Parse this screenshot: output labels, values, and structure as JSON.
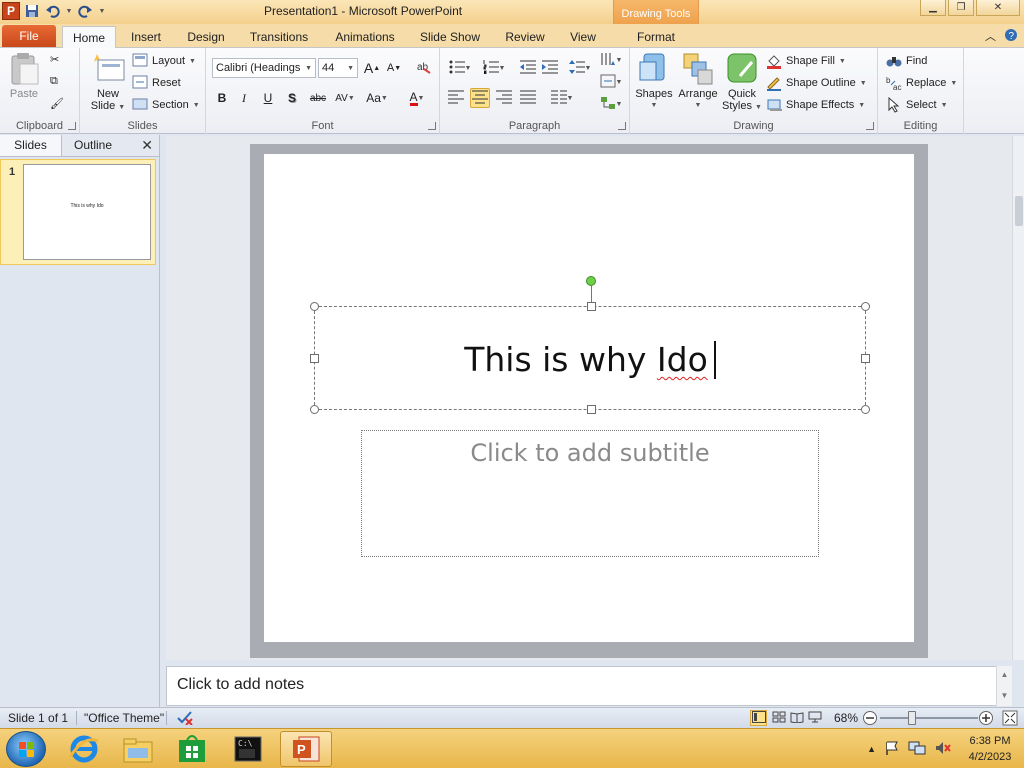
{
  "window": {
    "title": "Presentation1  -  Microsoft PowerPoint",
    "context_tab_group": "Drawing Tools",
    "app_icon_letter": "P"
  },
  "tabs": {
    "file": "File",
    "home": "Home",
    "insert": "Insert",
    "design": "Design",
    "transitions": "Transitions",
    "animations": "Animations",
    "slideshow": "Slide Show",
    "review": "Review",
    "view": "View",
    "format": "Format"
  },
  "ribbon": {
    "clipboard": {
      "label": "Clipboard",
      "paste": "Paste"
    },
    "slides": {
      "label": "Slides",
      "new_slide_l1": "New",
      "new_slide_l2": "Slide",
      "layout": "Layout",
      "reset": "Reset",
      "section": "Section"
    },
    "font": {
      "label": "Font",
      "font_name": "Calibri (Headings",
      "font_size": "44",
      "grow": "A",
      "shrink": "A",
      "bold": "B",
      "italic": "I",
      "underline": "U",
      "shadow": "S",
      "strike": "abc",
      "spacing": "AV",
      "change_case": "Aa",
      "color": "A"
    },
    "paragraph": {
      "label": "Paragraph"
    },
    "drawing": {
      "label": "Drawing",
      "shapes": "Shapes",
      "arrange": "Arrange",
      "quick_styles_l1": "Quick",
      "quick_styles_l2": "Styles",
      "shape_fill": "Shape Fill",
      "shape_outline": "Shape Outline",
      "shape_effects": "Shape Effects"
    },
    "editing": {
      "label": "Editing",
      "find": "Find",
      "replace": "Replace",
      "select": "Select"
    }
  },
  "left_pane": {
    "tab_slides": "Slides",
    "tab_outline": "Outline",
    "close": "✕",
    "thumbnails": [
      {
        "number": "1",
        "text": "This is why Ido"
      }
    ]
  },
  "slide": {
    "title_main": "This is why ",
    "title_misspelled": "Ido",
    "subtitle_placeholder": "Click to add subtitle"
  },
  "notes": {
    "placeholder": "Click to add notes"
  },
  "status": {
    "slide_counter": "Slide 1 of 1",
    "theme": "\"Office Theme\"",
    "zoom": "68%"
  },
  "taskbar": {
    "clock_time": "6:38 PM",
    "clock_date": "4/2/2023"
  },
  "colors": {
    "file_tab": "#d0521f",
    "context_tab": "#f0a550",
    "selection_highlight": "#fde28b",
    "spelling_error": "#dd2222"
  }
}
